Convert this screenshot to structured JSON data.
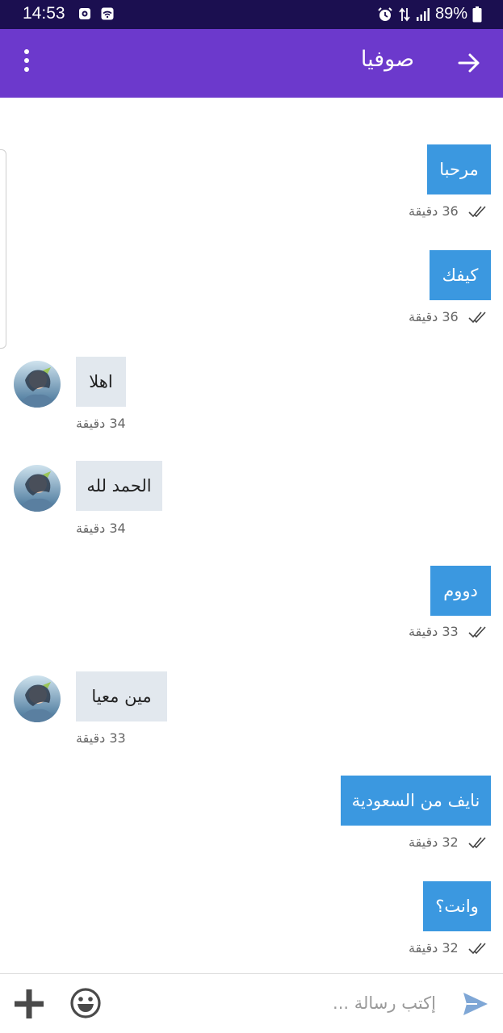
{
  "status_bar": {
    "time": "14:53",
    "battery": "89%",
    "icons": [
      "screen-record-icon",
      "wifi-icon",
      "alarm-icon",
      "data-arrows-icon",
      "signal-icon",
      "battery-icon"
    ]
  },
  "header": {
    "contact_name": "صوفيا",
    "icons": [
      "more-vert-icon",
      "back-arrow-icon"
    ],
    "color": "#6c39cc"
  },
  "messages": [
    {
      "direction": "sent",
      "text": "مرحبا",
      "time": "36 دقيقة",
      "status": "read"
    },
    {
      "direction": "sent",
      "text": "كيفك",
      "time": "36 دقيقة",
      "status": "read"
    },
    {
      "direction": "received",
      "text": "اهلا",
      "time": "34 دقيقة"
    },
    {
      "direction": "received",
      "text": "الحمد لله",
      "time": "34 دقيقة"
    },
    {
      "direction": "sent",
      "text": "دووم",
      "time": "33 دقيقة",
      "status": "read"
    },
    {
      "direction": "received",
      "text": "مين معيا",
      "time": "33 دقيقة"
    },
    {
      "direction": "sent",
      "text": "نايف من السعودية",
      "time": "32 دقيقة",
      "status": "read"
    },
    {
      "direction": "sent",
      "text": "وانت؟",
      "time": "32 دقيقة",
      "status": "read"
    }
  ],
  "composer": {
    "placeholder": "إكتب رسالة ...",
    "icons": [
      "plus-icon",
      "emoji-icon",
      "send-icon"
    ]
  },
  "colors": {
    "sent_bubble": "#3b98e0",
    "received_bubble": "#e2e8ee",
    "status_bar": "#1b0f50"
  }
}
